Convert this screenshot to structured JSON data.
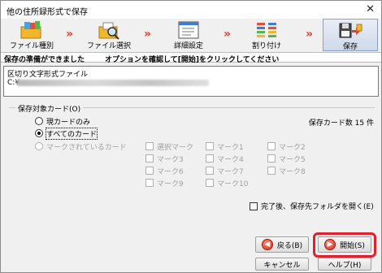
{
  "window": {
    "title": "他の住所録形式で保存",
    "close_glyph": "✕"
  },
  "steps": [
    {
      "label": "ファイル種別",
      "icon": "folder-files-icon"
    },
    {
      "label": "ファイル選択",
      "icon": "folder-search-icon"
    },
    {
      "label": "詳細設定",
      "icon": "settings-window-icon"
    },
    {
      "label": "割り付け",
      "icon": "list-assign-icon"
    },
    {
      "label": "保存",
      "icon": "save-floppy-icon",
      "active": true
    }
  ],
  "step_arrow": "»",
  "info": {
    "main": "保存の準備ができました",
    "hint": "オプションを確認して[開始]をクリックしてください"
  },
  "file": {
    "format": "区切り文字形式ファイル",
    "path_prefix": "C:¥"
  },
  "group": {
    "legend": "保存対象カード(O)",
    "count_label": "保存カード数 15 件",
    "radios": [
      {
        "label": "現カードのみ",
        "checked": false,
        "disabled": false
      },
      {
        "label": "すべてのカード",
        "checked": true,
        "disabled": false
      },
      {
        "label": "マークされているカード",
        "checked": false,
        "disabled": true
      }
    ],
    "marks": [
      "選択マーク",
      "マーク1",
      "マーク2",
      "マーク3",
      "マーク4",
      "マーク5",
      "マーク6",
      "マーク7",
      "マーク8",
      "マーク9",
      "マーク10"
    ]
  },
  "options": {
    "open_folder": "完了後、保存先フォルダを開く(E)"
  },
  "buttons": {
    "back": "戻る(B)",
    "start": "開始(S)",
    "cancel": "キャンセル",
    "help": "ヘルプ(H)"
  },
  "colors": {
    "accent": "#e0202c",
    "arrow": "#e8392f"
  }
}
